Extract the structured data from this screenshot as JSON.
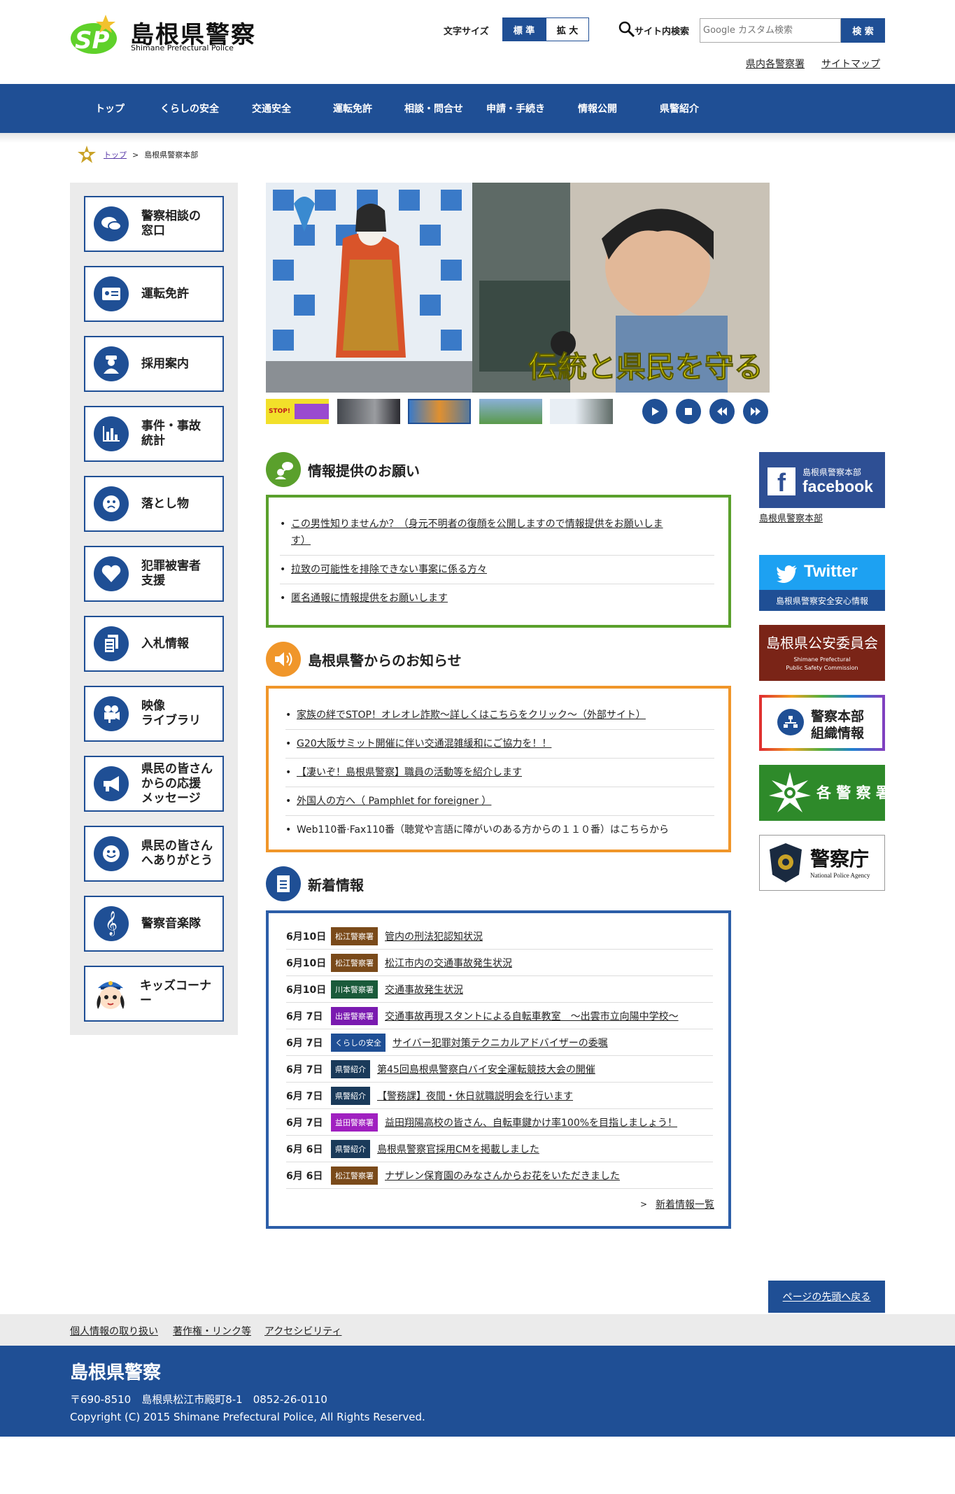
{
  "header": {
    "site_title": "島根県警察",
    "site_subtitle": "Shimane Prefectural Police",
    "fontsize_label": "文字サイズ",
    "fontsize_standard": "標 準",
    "fontsize_large": "拡 大",
    "search_label": "サイト内検索",
    "search_placeholder": "Google カスタム検索",
    "search_button": "検 索",
    "link_stations": "県内各警察署",
    "link_sitemap": "サイトマップ"
  },
  "gnav": [
    "トップ",
    "くらしの安全",
    "交通安全",
    "運転免許",
    "相談・問合せ",
    "申請・手続き",
    "情報公開",
    "県警紹介"
  ],
  "breadcrumb": {
    "home": "トップ",
    "separator": ">",
    "current": "島根県警察本部"
  },
  "sidemenu": [
    {
      "label": "警察相談の\n窓口",
      "icon": "chat-bubbles-icon"
    },
    {
      "label": "運転免許",
      "icon": "license-card-icon"
    },
    {
      "label": "採用案内",
      "icon": "police-officer-icon"
    },
    {
      "label": "事件・事故\n統計",
      "icon": "bar-chart-icon"
    },
    {
      "label": "落とし物",
      "icon": "sad-face-icon"
    },
    {
      "label": "犯罪被害者\n支援",
      "icon": "heart-icon"
    },
    {
      "label": "入札情報",
      "icon": "documents-icon"
    },
    {
      "label": "映像\nライブラリ",
      "icon": "video-camera-icon"
    },
    {
      "label": "県民の皆さん\nからの応援\nメッセージ",
      "icon": "megaphone-icon"
    },
    {
      "label": "県民の皆さん\nへありがとう",
      "icon": "smile-face-icon"
    },
    {
      "label": "警察音楽隊",
      "icon": "treble-clef-icon"
    },
    {
      "label": "キッズコーナー",
      "icon": "kid-mascot-icon"
    }
  ],
  "slideshow": {
    "caption": "伝統と県民を守る",
    "thumb1_text": "STOP!"
  },
  "info_request": {
    "title": "情報提供のお願い",
    "items": [
      "この男性知りませんか？（身元不明者の復顔を公開しますので情報提供をお願いしま\nす）",
      "拉致の可能性を排除できない事案に係る方々",
      "匿名通報に情報提供をお願いします"
    ]
  },
  "notices": {
    "title": "島根県警からのお知らせ",
    "items": [
      "家族の絆でSTOP！オレオレ詐欺～詳しくはこちらをクリック～（外部サイト）",
      "G20大阪サミット開催に伴い交通混雑緩和にご協力を！！",
      "【凄いぞ！島根県警察】職員の活動等を紹介します",
      "外国人の方へ（ Pamphlet for foreigner ）",
      "Web110番·Fax110番（聴覚や言語に障がいのある方からの１１０番）はこちらから"
    ]
  },
  "news": {
    "title": "新着情報",
    "items": [
      {
        "date": "6月10日",
        "tag": "松江警察署",
        "tag_color": "#7a4a1a",
        "text": "管内の刑法犯認知状況"
      },
      {
        "date": "6月10日",
        "tag": "松江警察署",
        "tag_color": "#7a4a1a",
        "text": "松江市内の交通事故発生状況"
      },
      {
        "date": "6月10日",
        "tag": "川本警察署",
        "tag_color": "#1a5a3a",
        "text": "交通事故発生状況"
      },
      {
        "date": "6月 7日",
        "tag": "出雲警察署",
        "tag_color": "#7a1ab0",
        "text": "交通事故再現スタントによる自転車教室　～出雲市立向陽中学校～"
      },
      {
        "date": "6月 7日",
        "tag": "くらしの安全",
        "tag_color": "#1f4f95",
        "text": "サイバー犯罪対策テクニカルアドバイザーの委嘱"
      },
      {
        "date": "6月 7日",
        "tag": "県警紹介",
        "tag_color": "#1a3a5a",
        "text": "第45回島根県警察白バイ安全運転競技大会の開催"
      },
      {
        "date": "6月 7日",
        "tag": "県警紹介",
        "tag_color": "#1a3a5a",
        "text": "【警務課】夜間・休日就職説明会を行います"
      },
      {
        "date": "6月 7日",
        "tag": "益田警察署",
        "tag_color": "#a020c0",
        "text": "益田翔陽高校の皆さん、自転車鍵かけ率100%を目指しましょう！"
      },
      {
        "date": "6月 6日",
        "tag": "県警紹介",
        "tag_color": "#1a3a5a",
        "text": "島根県警察官採用CMを掲載しました"
      },
      {
        "date": "6月 6日",
        "tag": "松江警察署",
        "tag_color": "#7a4a1a",
        "text": "ナザレン保育園のみなさんからお花をいただきました"
      }
    ],
    "more": "新着情報一覧"
  },
  "banners": {
    "facebook_sub": "島根県警察本部",
    "facebook_main": "facebook",
    "facebook_caption": "島根県警察本部",
    "twitter_main": "Twitter",
    "twitter_sub": "島根県警察安全安心情報",
    "psc_main": "島根県公安委員会",
    "psc_sub1": "Shimane Prefectural",
    "psc_sub2": "Public Safety Commission",
    "org_line1": "警察本部",
    "org_line2": "組織情報",
    "stations": "各 警 察 署",
    "npa_main": "警察庁",
    "npa_sub": "National Police Agency"
  },
  "pagetop": "ページの先頭へ戻る",
  "footer": {
    "links": [
      "個人情報の取り扱い",
      "著作権・リンク等",
      "アクセシビリティ"
    ],
    "title": "島根県警察",
    "address": "〒690-8510　島根県松江市殿町8-1　0852-26-0110",
    "copyright": "Copyright (C) 2015 Shimane Prefectural Police, All Rights Reserved."
  },
  "colors": {
    "brand_blue": "#1f4f95",
    "green": "#5aa02c",
    "orange": "#f0962a",
    "news_blue": "#2c5ea8"
  }
}
